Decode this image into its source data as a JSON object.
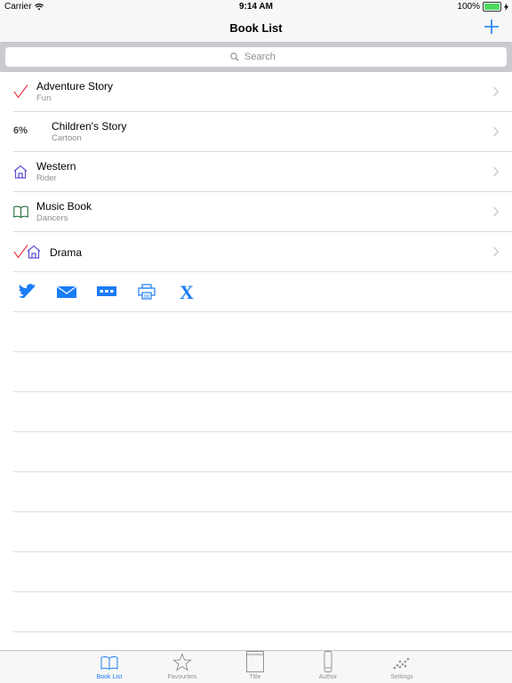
{
  "status": {
    "carrier": "Carrier",
    "time": "9:14 AM",
    "battery": "100%"
  },
  "nav": {
    "title": "Book List",
    "add_icon": "plus-icon"
  },
  "search": {
    "placeholder": "Search"
  },
  "books": [
    {
      "title": "Adventure Story",
      "subtitle": "Fun",
      "status_icon": "checkmark-icon"
    },
    {
      "title": "Children's Story",
      "subtitle": "Cartoon",
      "progress": "6%"
    },
    {
      "title": "Western",
      "subtitle": "Rider",
      "status_icon": "house-icon"
    },
    {
      "title": "Music Book",
      "subtitle": "Dancers",
      "status_icon": "open-book-icon"
    },
    {
      "title": "Drama",
      "subtitle": "",
      "status_icon": "checkmark-house-icon"
    }
  ],
  "share_buttons": [
    "twitter-icon",
    "mail-icon",
    "message-icon",
    "print-icon",
    "x-icon"
  ],
  "tabs": [
    {
      "label": "Book List",
      "icon": "open-book-icon",
      "active": true
    },
    {
      "label": "Favourites",
      "icon": "star-icon",
      "active": false
    },
    {
      "label": "Title",
      "icon": "book-cover-icon",
      "active": false
    },
    {
      "label": "Author",
      "icon": "book-spine-icon",
      "active": false
    },
    {
      "label": "Settings",
      "icon": "dots-icon",
      "active": false
    }
  ],
  "colors": {
    "accent": "#1a7cf6",
    "check": "#e8394a",
    "house": "#5b4fd6",
    "book": "#1e6a3a",
    "tab_inactive": "#929292"
  }
}
